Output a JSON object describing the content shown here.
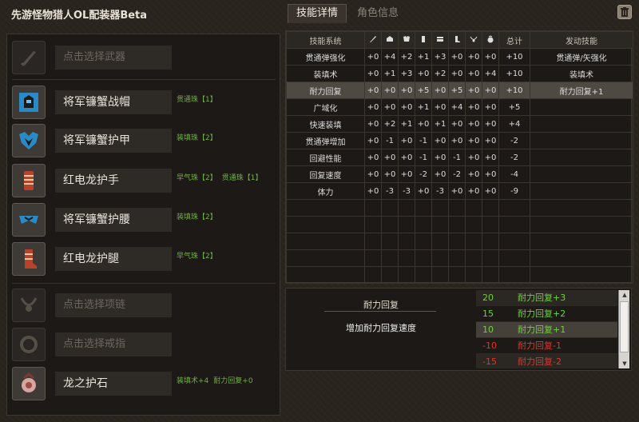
{
  "app_title": "先游怪物猎人OL配装器Beta",
  "tabs": [
    {
      "label": "技能详情",
      "active": true
    },
    {
      "label": "角色信息",
      "active": false
    }
  ],
  "slots": [
    {
      "name": "点击选择武器",
      "empty": true,
      "icon": "sword-icon",
      "decos": []
    },
    {
      "name": "将军镰蟹战帽",
      "empty": false,
      "icon": "helmet-icon",
      "decos": [
        "贯通珠【1】"
      ]
    },
    {
      "name": "将军镰蟹护甲",
      "empty": false,
      "icon": "chest-armor-icon",
      "decos": [
        "装填珠【2】"
      ]
    },
    {
      "name": "红电龙护手",
      "empty": false,
      "icon": "gauntlet-icon",
      "decos": [
        "早气珠【2】",
        "贯通珠【1】"
      ]
    },
    {
      "name": "将军镰蟹护腰",
      "empty": false,
      "icon": "waist-armor-icon",
      "decos": [
        "装填珠【2】"
      ]
    },
    {
      "name": "红电龙护腿",
      "empty": false,
      "icon": "leg-armor-icon",
      "decos": [
        "早气珠【2】"
      ]
    },
    {
      "name": "点击选择项链",
      "empty": true,
      "icon": "necklace-icon",
      "decos": []
    },
    {
      "name": "点击选择戒指",
      "empty": true,
      "icon": "ring-icon",
      "decos": []
    },
    {
      "name": "龙之护石",
      "empty": false,
      "icon": "charm-icon",
      "decos": [
        "装填术+4",
        "耐力回复+0"
      ]
    }
  ],
  "skill_table": {
    "headers": {
      "system": "技能系统",
      "total": "总计",
      "activated": "发动技能"
    },
    "column_icons": [
      "weapon-col-icon",
      "helmet-col-icon",
      "chest-col-icon",
      "arm-col-icon",
      "waist-col-icon",
      "leg-col-icon",
      "necklace-col-icon",
      "charm-col-icon"
    ],
    "rows": [
      {
        "name": "贯通弹强化",
        "vals": [
          "+0",
          "+4",
          "+2",
          "+1",
          "+3",
          "+0",
          "+0",
          "+0"
        ],
        "total": "+10",
        "skill": "贯通弹/矢强化"
      },
      {
        "name": "装填术",
        "vals": [
          "+0",
          "+1",
          "+3",
          "+0",
          "+2",
          "+0",
          "+0",
          "+4"
        ],
        "total": "+10",
        "skill": "装填术"
      },
      {
        "name": "耐力回复",
        "vals": [
          "+0",
          "+0",
          "+0",
          "+5",
          "+0",
          "+5",
          "+0",
          "+0"
        ],
        "total": "+10",
        "skill": "耐力回复+1",
        "selected": true
      },
      {
        "name": "广域化",
        "vals": [
          "+0",
          "+0",
          "+0",
          "+1",
          "+0",
          "+4",
          "+0",
          "+0"
        ],
        "total": "+5",
        "skill": ""
      },
      {
        "name": "快速装填",
        "vals": [
          "+0",
          "+2",
          "+1",
          "+0",
          "+1",
          "+0",
          "+0",
          "+0"
        ],
        "total": "+4",
        "skill": ""
      },
      {
        "name": "贯通弹增加",
        "vals": [
          "+0",
          "-1",
          "+0",
          "-1",
          "+0",
          "+0",
          "+0",
          "+0"
        ],
        "total": "-2",
        "skill": ""
      },
      {
        "name": "回避性能",
        "vals": [
          "+0",
          "+0",
          "+0",
          "-1",
          "+0",
          "-1",
          "+0",
          "+0"
        ],
        "total": "-2",
        "skill": ""
      },
      {
        "name": "回复速度",
        "vals": [
          "+0",
          "+0",
          "+0",
          "-2",
          "+0",
          "-2",
          "+0",
          "+0"
        ],
        "total": "-4",
        "skill": ""
      },
      {
        "name": "体力",
        "vals": [
          "+0",
          "-3",
          "-3",
          "+0",
          "-3",
          "+0",
          "+0",
          "+0"
        ],
        "total": "-9",
        "skill": ""
      }
    ],
    "empty_rows": 5
  },
  "detail": {
    "name": "耐力回复",
    "description": "增加耐力回复速度",
    "levels": [
      {
        "points": "20",
        "skill": "耐力回复+3",
        "color": "#6fd23c"
      },
      {
        "points": "15",
        "skill": "耐力回复+2",
        "color": "#6fd23c"
      },
      {
        "points": "10",
        "skill": "耐力回复+1",
        "color": "#6fd23c",
        "selected": true
      },
      {
        "points": "-10",
        "skill": "耐力回复-1",
        "color": "#e0352b"
      },
      {
        "points": "-15",
        "skill": "耐力回复-2",
        "color": "#e0352b"
      }
    ]
  },
  "colors": {
    "deco_green": "#6fb33c",
    "positive_green": "#6fd23c",
    "negative_red": "#e0352b"
  }
}
